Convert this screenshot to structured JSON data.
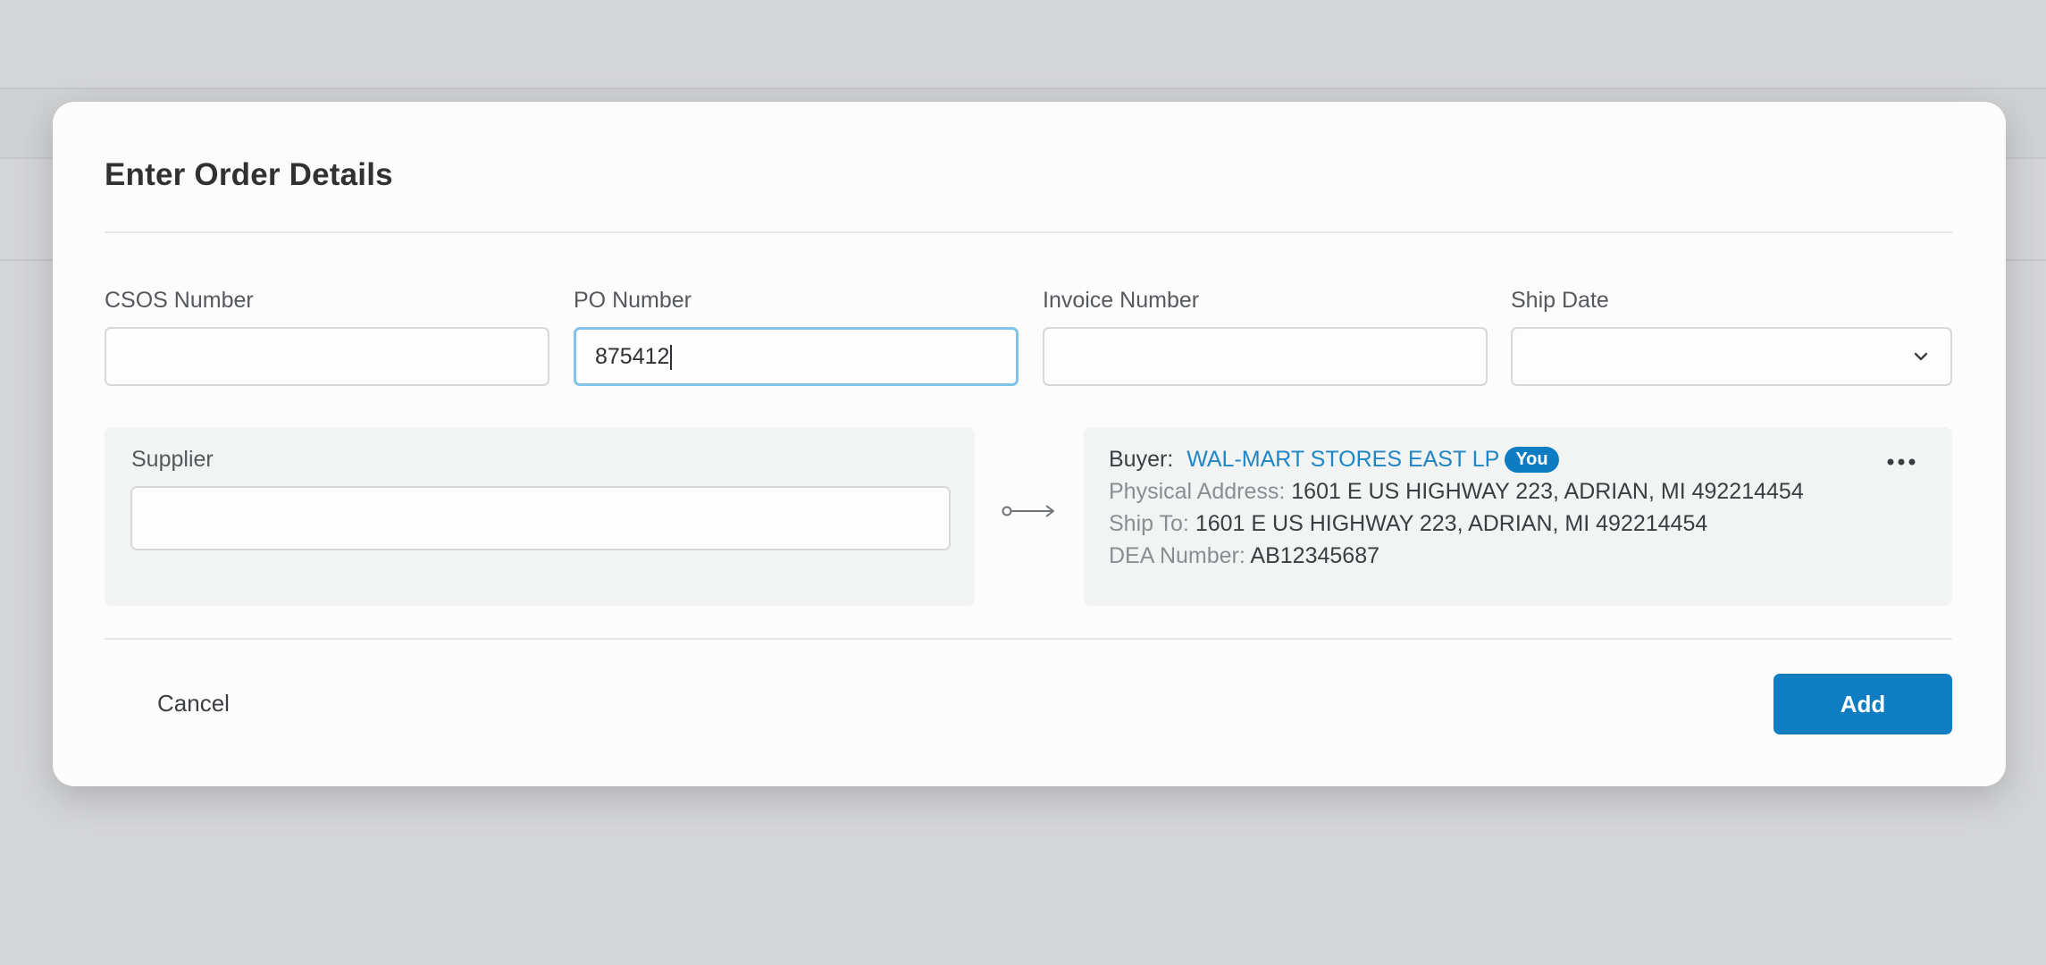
{
  "modal": {
    "title": "Enter Order Details"
  },
  "fields": {
    "csos": {
      "label": "CSOS Number",
      "value": ""
    },
    "po": {
      "label": "PO Number",
      "value": "875412"
    },
    "invoice": {
      "label": "Invoice Number",
      "value": ""
    },
    "ship_date": {
      "label": "Ship Date",
      "value": ""
    }
  },
  "supplier": {
    "label": "Supplier",
    "value": ""
  },
  "buyer": {
    "label": "Buyer:",
    "name": "WAL-MART STORES EAST LP",
    "badge": "You",
    "physical_address_label": "Physical Address:",
    "physical_address": "1601 E US HIGHWAY 223, ADRIAN, MI 492214454",
    "ship_to_label": "Ship To:",
    "ship_to": "1601 E US HIGHWAY 223, ADRIAN, MI 492214454",
    "dea_label": "DEA Number:",
    "dea": "AB12345687"
  },
  "actions": {
    "cancel": "Cancel",
    "add": "Add"
  },
  "icons": {
    "ship_date_dropdown": "chevron-down-icon",
    "flow_arrow": "arrow-right-icon",
    "buyer_menu": "more-horizontal-icon"
  },
  "colors": {
    "accent": "#0f7dc2",
    "link": "#1e86c6",
    "focus_border": "#7fc3ea"
  }
}
